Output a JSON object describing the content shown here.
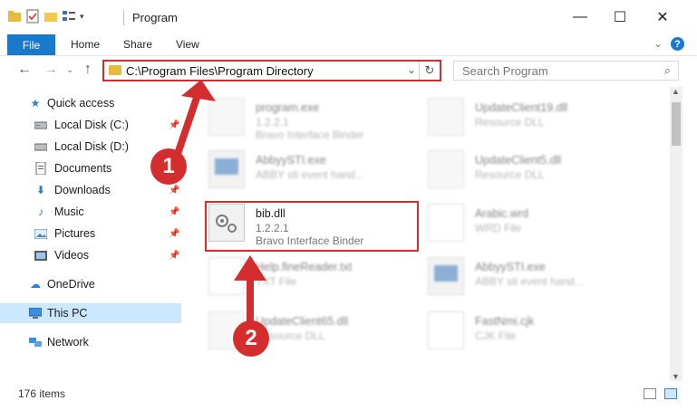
{
  "window": {
    "title": "Program",
    "controls": {
      "minimize": "—",
      "maximize": "☐",
      "close": "✕"
    }
  },
  "ribbon": {
    "file": "File",
    "tabs": [
      "Home",
      "Share",
      "View"
    ],
    "help": "?"
  },
  "navigation": {
    "address": "C:\\Program Files\\Program Directory",
    "search_placeholder": "Search Program"
  },
  "sidebar": {
    "items": [
      {
        "label": "Quick access",
        "icon": "star-icon"
      },
      {
        "label": "Local Disk (C:)",
        "icon": "drive-icon"
      },
      {
        "label": "Local Disk (D:)",
        "icon": "drive-icon"
      },
      {
        "label": "Documents",
        "icon": "documents-icon"
      },
      {
        "label": "Downloads",
        "icon": "download-icon"
      },
      {
        "label": "Music",
        "icon": "music-icon"
      },
      {
        "label": "Pictures",
        "icon": "pictures-icon"
      },
      {
        "label": "Videos",
        "icon": "videos-icon"
      },
      {
        "label": "OneDrive",
        "icon": "cloud-icon"
      },
      {
        "label": "This PC",
        "icon": "computer-icon"
      },
      {
        "label": "Network",
        "icon": "network-icon"
      }
    ]
  },
  "files": [
    {
      "name": "program.exe",
      "line2": "1.2.2.1",
      "line3": "Bravo Interface Binder"
    },
    {
      "name": "UpdateClient19.dll",
      "line2": "Resource DLL",
      "line3": ""
    },
    {
      "name": "AbbyySTI.exe",
      "line2": "ABBY sti event hand...",
      "line3": ""
    },
    {
      "name": "UpdateClient5.dll",
      "line2": "Resource DLL",
      "line3": ""
    },
    {
      "name": "bib.dll",
      "line2": "1.2.2.1",
      "line3": "Bravo Interface Binder"
    },
    {
      "name": "Arabic.wrd",
      "line2": "WRD File",
      "line3": ""
    },
    {
      "name": "Help.fineReader.txt",
      "line2": "TXT File",
      "line3": ""
    },
    {
      "name": "AbbyySTI.exe",
      "line2": "ABBY sti event hand...",
      "line3": ""
    },
    {
      "name": "UpdateClient65.dll",
      "line2": "Resource DLL",
      "line3": ""
    },
    {
      "name": "FastNmi.cjk",
      "line2": "CJK File",
      "line3": ""
    }
  ],
  "status": {
    "count": "176 items"
  },
  "callouts": [
    "1",
    "2"
  ],
  "accent_color": "#1979ca",
  "highlight_color": "#d42d2d"
}
